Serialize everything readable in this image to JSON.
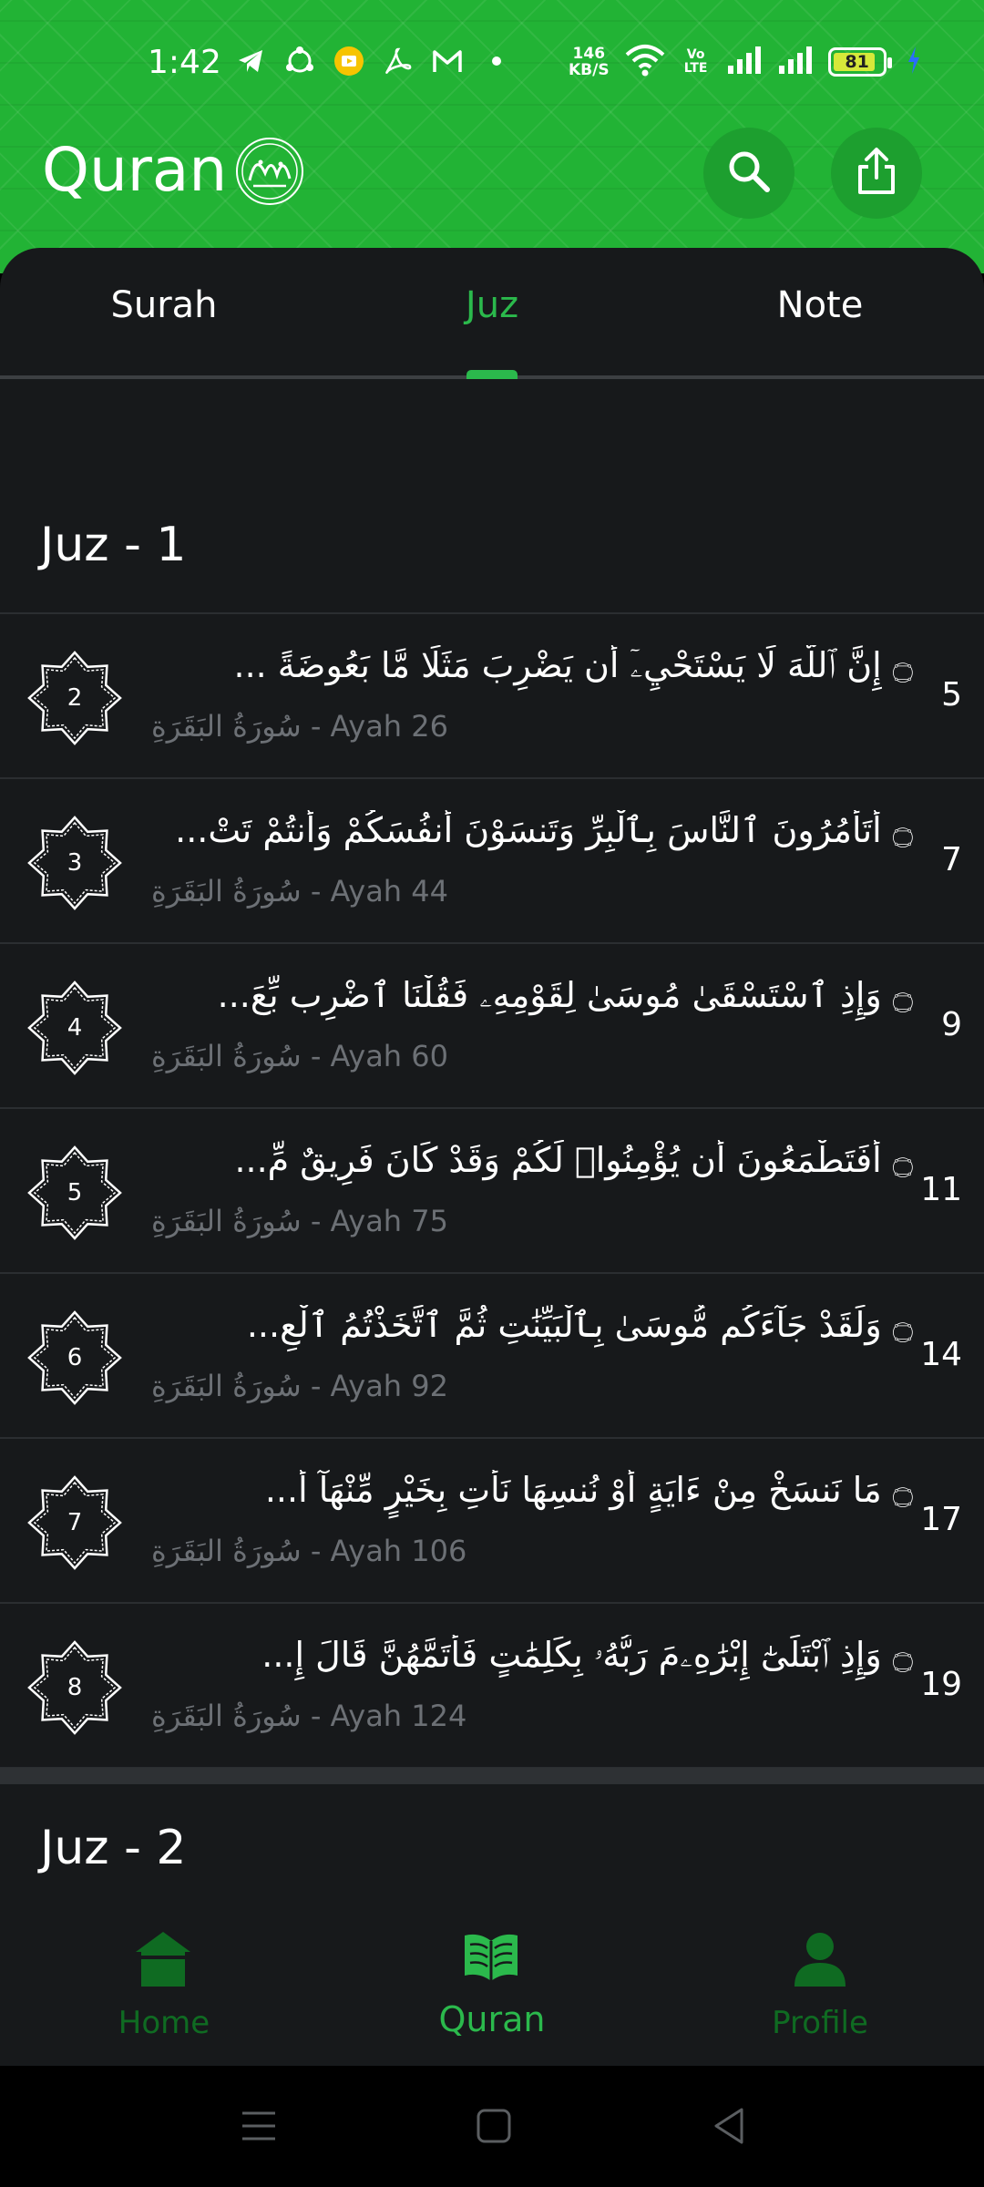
{
  "status_bar": {
    "time": "1:42",
    "network_speed_value": "146",
    "network_speed_unit": "KB/S",
    "volte_label": "Vo LTE",
    "battery_level": "81",
    "icons": [
      "telegram-icon",
      "sync-icon",
      "yellow-app-icon",
      "acrobat-icon",
      "gmail-icon",
      "dot-icon",
      "wifi-icon",
      "signal-icon",
      "signal-icon",
      "battery-icon",
      "charging-icon"
    ]
  },
  "header": {
    "title": "Quran",
    "logo_icon": "quran-calligraphy-logo",
    "search_icon": "search-icon",
    "share_icon": "share-icon"
  },
  "tabs": [
    {
      "label": "Surah",
      "active": false
    },
    {
      "label": "Juz",
      "active": true
    },
    {
      "label": "Note",
      "active": false
    }
  ],
  "sections": [
    {
      "title": "Juz - 1",
      "rows": [
        {
          "badge": "2",
          "text": "إِنَّ ٱللَّهَ لَا يَسْتَحْيِۦٓ أَن يَضْرِبَ مَثَلًا مَّا بَعُوضَةً ...",
          "meta": "سُورَةُ البَقَرَةِ - Ayah 26",
          "page": "5"
        },
        {
          "badge": "3",
          "text": "أَتَأْمُرُونَ ٱلنَّاسَ بِٱلْبِرِّ وَتَنسَوْنَ أَنفُسَكُمْ وَأَنتُمْ تَتْ...",
          "meta": "سُورَةُ البَقَرَةِ - Ayah 44",
          "page": "7"
        },
        {
          "badge": "4",
          "text": "وَإِذِ ٱسْتَسْقَىٰ مُوسَىٰ لِقَوْمِهِۦ فَقُلْنَا ٱضْرِب بِّعَ...",
          "meta": "سُورَةُ البَقَرَةِ - Ayah 60",
          "page": "9"
        },
        {
          "badge": "5",
          "text": "أَفَتَطْمَعُونَ أَن يُؤْمِنُوا۟ لَكُمْ وَقَدْ كَانَ فَرِيقٌ مِّ...",
          "meta": "سُورَةُ البَقَرَةِ - Ayah 75",
          "page": "11"
        },
        {
          "badge": "6",
          "text": "وَلَقَدْ جَآءَكُم مُّوسَىٰ بِٱلْبَيِّنَٰتِ ثُمَّ ٱتَّخَذْتُمُ ٱلْعِ...",
          "meta": "سُورَةُ البَقَرَةِ - Ayah 92",
          "page": "14"
        },
        {
          "badge": "7",
          "text": "مَا نَنسَخْ مِنْ ءَايَةٍ أَوْ نُنسِهَا نَأْتِ بِخَيْرٍ مِّنْهَآ أَ...",
          "meta": "سُورَةُ البَقَرَةِ - Ayah 106",
          "page": "17"
        },
        {
          "badge": "8",
          "text": "وَإِذِ ٱبْتَلَىٰٓ إِبْرَٰهِۦمَ رَبُّهُۥ بِكَلِمَٰتٍ فَأَتَمَّهُنَّ قَالَ إِ...",
          "meta": "سُورَةُ البَقَرَةِ - Ayah 124",
          "page": "19"
        }
      ]
    },
    {
      "title": "Juz - 2",
      "rows": []
    }
  ],
  "ayah_marker": "۝",
  "bottom_nav": [
    {
      "label": "Home",
      "icon": "home-icon",
      "active": false
    },
    {
      "label": "Quran",
      "icon": "open-book-icon",
      "active": true
    },
    {
      "label": "Profile",
      "icon": "profile-icon",
      "active": false
    }
  ],
  "colors": {
    "header_green": "#22b335",
    "accent_green": "#2bb94c",
    "inactive_nav_green": "#0f6b22",
    "sheet_bg": "#17191b",
    "meta_gray": "#6c7075"
  }
}
